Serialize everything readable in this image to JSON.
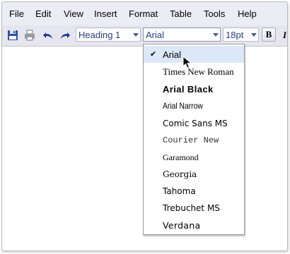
{
  "menubar": {
    "items": [
      "File",
      "Edit",
      "View",
      "Insert",
      "Format",
      "Table",
      "Tools",
      "Help"
    ]
  },
  "toolbar": {
    "icons": [
      "save-icon",
      "print-icon",
      "undo-icon",
      "redo-icon"
    ],
    "paragraph_style": "Heading 1",
    "font_family": "Arial",
    "font_size": "18pt",
    "bold_label": "B"
  },
  "font_menu": {
    "selected": "Arial",
    "check_glyph": "✔",
    "items": [
      "Arial",
      "Times New Roman",
      "Arial Black",
      "Arial Narrow",
      "Comic Sans MS",
      "Courier New",
      "Garamond",
      "Georgia",
      "Tahoma",
      "Trebuchet MS",
      "Verdana"
    ]
  },
  "colors": {
    "menubar_bg": "#ececf4",
    "toolbar_bg": "#e6e6f0",
    "selected_item_bg": "#dce7f7",
    "combo_text": "#2b3d80"
  }
}
